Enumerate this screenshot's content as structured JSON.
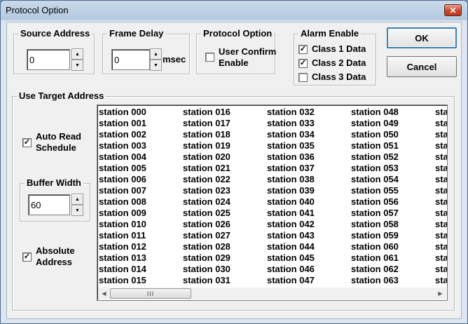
{
  "window": {
    "title": "Protocol Option",
    "close_glyph": "✕"
  },
  "source_address": {
    "label": "Source Address",
    "value": "0"
  },
  "frame_delay": {
    "label": "Frame Delay",
    "value": "0",
    "unit": "msec"
  },
  "protocol_option": {
    "label": "Protocol Option",
    "user_confirm": {
      "label_line1": "User Confirm",
      "label_line2": "Enable",
      "checked": false
    }
  },
  "alarm_enable": {
    "label": "Alarm Enable",
    "class1": {
      "label": "Class 1 Data",
      "checked": true
    },
    "class2": {
      "label": "Class 2 Data",
      "checked": true
    },
    "class3": {
      "label": "Class 3 Data",
      "checked": false
    }
  },
  "buttons": {
    "ok": "OK",
    "cancel": "Cancel"
  },
  "target_address": {
    "label": "Use Target Address",
    "auto_read": {
      "label_line1": "Auto Read",
      "label_line2": "Schedule",
      "checked": true
    },
    "buffer_width": {
      "label": "Buffer Width",
      "value": "60"
    },
    "absolute": {
      "label_line1": "Absolute",
      "label_line2": "Address",
      "checked": true
    },
    "stations": [
      [
        "station 000",
        "station 001",
        "station 002",
        "station 003",
        "station 004",
        "station 005",
        "station 006",
        "station 007",
        "station 008",
        "station 009",
        "station 010",
        "station 011",
        "station 012",
        "station 013",
        "station 014",
        "station 015"
      ],
      [
        "station 016",
        "station 017",
        "station 018",
        "station 019",
        "station 020",
        "station 021",
        "station 022",
        "station 023",
        "station 024",
        "station 025",
        "station 026",
        "station 027",
        "station 028",
        "station 029",
        "station 030",
        "station 031"
      ],
      [
        "station 032",
        "station 033",
        "station 034",
        "station 035",
        "station 036",
        "station 037",
        "station 038",
        "station 039",
        "station 040",
        "station 041",
        "station 042",
        "station 043",
        "station 044",
        "station 045",
        "station 046",
        "station 047"
      ],
      [
        "station 048",
        "station 049",
        "station 050",
        "station 051",
        "station 052",
        "station 053",
        "station 054",
        "station 055",
        "station 056",
        "station 057",
        "station 058",
        "station 059",
        "station 060",
        "station 061",
        "station 062",
        "station 063"
      ],
      [
        "sta",
        "sta",
        "sta",
        "sta",
        "sta",
        "sta",
        "sta",
        "sta",
        "sta",
        "sta",
        "sta",
        "sta",
        "sta",
        "sta",
        "sta",
        "sta"
      ]
    ]
  },
  "scrollbar": {
    "left_glyph": "◀",
    "right_glyph": "▶",
    "thumb_grip": "III"
  },
  "spinner": {
    "up_glyph": "▲",
    "down_glyph": "▼"
  },
  "checkmark_glyph": "✓"
}
